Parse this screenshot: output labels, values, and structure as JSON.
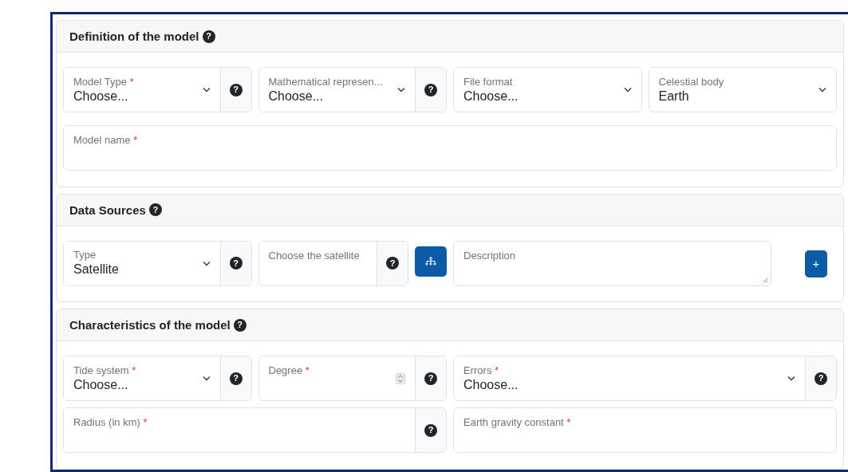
{
  "sections": [
    {
      "title": "Definition of the model",
      "help": "?",
      "rows": [
        {
          "fields": [
            {
              "kind": "select",
              "label": "Model Type",
              "required_mark": "*",
              "value": "Choose...",
              "help": "?"
            },
            {
              "kind": "select",
              "label": "Mathematical represen...",
              "value": "Choose...",
              "help": "?"
            },
            {
              "kind": "select",
              "label": "File format",
              "value": "Choose..."
            },
            {
              "kind": "select",
              "label": "Celestial body",
              "value": "Earth"
            }
          ]
        },
        {
          "fields": [
            {
              "kind": "text",
              "label": "Model name",
              "required_mark": "*"
            }
          ]
        }
      ]
    },
    {
      "title": "Data Sources",
      "help": "?",
      "rows": [
        {
          "fields": [
            {
              "kind": "select",
              "label": "Type",
              "value": "Satellite",
              "help": "?"
            },
            {
              "kind": "text",
              "label": "Choose the satellite",
              "help": "?"
            },
            {
              "kind": "tree-button"
            },
            {
              "kind": "textarea",
              "label": "Description"
            },
            {
              "kind": "add-button",
              "text": "+"
            }
          ]
        }
      ]
    },
    {
      "title": "Characteristics of the model",
      "help": "?",
      "rows": [
        {
          "fields": [
            {
              "kind": "select",
              "label": "Tide system",
              "required_mark": "*",
              "value": "Choose...",
              "help": "?"
            },
            {
              "kind": "number",
              "label": "Degree",
              "required_mark": "*",
              "help": "?"
            },
            {
              "kind": "select",
              "label": "Errors",
              "required_mark": "*",
              "value": "Choose...",
              "help": "?"
            }
          ]
        },
        {
          "fields": [
            {
              "kind": "text",
              "label": "Radius (in km)",
              "required_mark": "*",
              "help": "?"
            },
            {
              "kind": "text",
              "label": "Earth gravity constant",
              "required_mark": "*"
            }
          ]
        }
      ]
    }
  ]
}
